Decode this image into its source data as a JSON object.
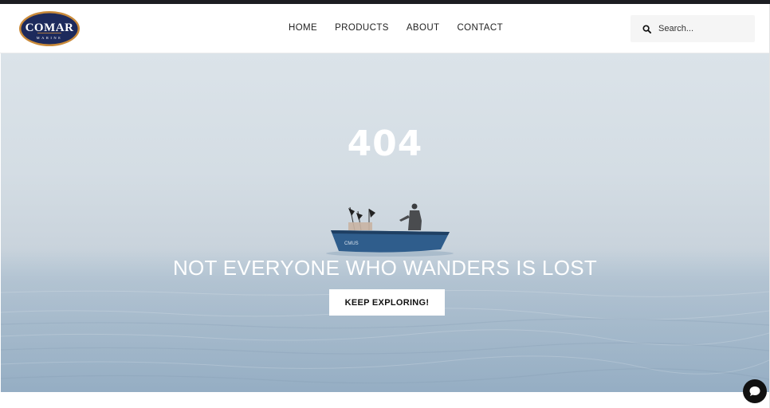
{
  "brand": {
    "logo_text": "COMAR",
    "logo_subtext": "MARINE",
    "colors": {
      "navy": "#1d2a5c",
      "gold": "#c98a3a"
    }
  },
  "nav": {
    "items": [
      {
        "label": "HOME"
      },
      {
        "label": "PRODUCTS"
      },
      {
        "label": "ABOUT"
      },
      {
        "label": "CONTACT"
      }
    ]
  },
  "search": {
    "placeholder": "Search...",
    "icon": "search-icon"
  },
  "hero": {
    "error_code": "404",
    "tagline": "NOT EVERYONE WHO WANDERS IS LOST",
    "cta_label": "KEEP EXPLORING!",
    "boat_label": "CMUS"
  },
  "chat": {
    "icon": "chat-icon",
    "color": "#111111"
  }
}
